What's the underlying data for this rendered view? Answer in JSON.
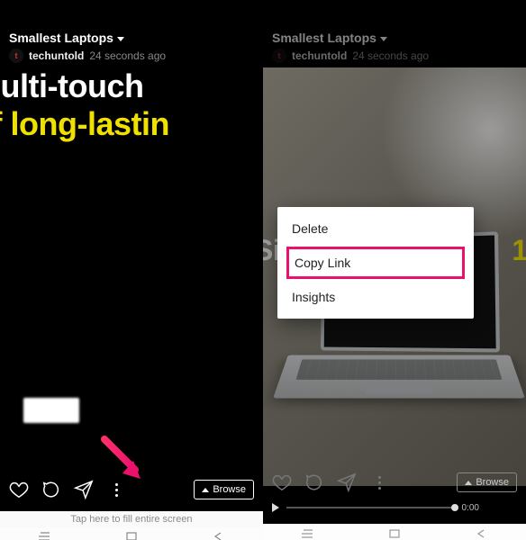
{
  "left": {
    "header_title": "Smallest Laptops",
    "username": "techuntold",
    "timestamp": "24 seconds ago",
    "line1": "a multi-touch",
    "line2": "s of long-lastin",
    "browse_label": "Browse",
    "fill_hint": "Tap here to fill entire screen"
  },
  "right": {
    "header_title": "Smallest Laptops",
    "username": "techuntold",
    "timestamp": "24 seconds ago",
    "mid_prefix": "Si",
    "mid_suffix": "1.",
    "browse_label": "Browse",
    "playback_time": "0:00",
    "menu": {
      "delete": "Delete",
      "copy_link": "Copy Link",
      "insights": "Insights"
    }
  },
  "colors": {
    "highlight": "#e9116c",
    "yellow": "#f0e000"
  }
}
